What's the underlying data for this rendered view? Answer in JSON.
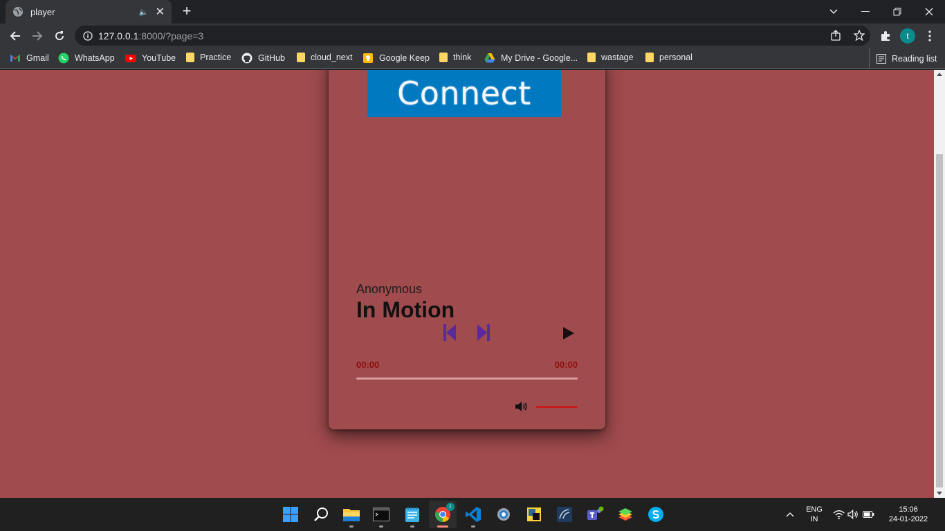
{
  "browser": {
    "tab_title": "player",
    "address": {
      "host": "127.0.0.1",
      "path": ":8000/?page=3"
    },
    "profile_initial": "t",
    "bookmarks": [
      {
        "label": "Gmail",
        "icon": "gmail-icon"
      },
      {
        "label": "WhatsApp",
        "icon": "whatsapp-icon"
      },
      {
        "label": "YouTube",
        "icon": "youtube-icon"
      },
      {
        "label": "Practice",
        "icon": "folder-icon"
      },
      {
        "label": "GitHub",
        "icon": "github-icon"
      },
      {
        "label": "cloud_next",
        "icon": "folder-icon"
      },
      {
        "label": "Google Keep",
        "icon": "keep-icon"
      },
      {
        "label": "think",
        "icon": "folder-icon"
      },
      {
        "label": "My Drive - Google...",
        "icon": "drive-icon"
      },
      {
        "label": "wastage",
        "icon": "folder-icon"
      },
      {
        "label": "personal",
        "icon": "folder-icon"
      }
    ],
    "reading_list": "Reading list"
  },
  "player": {
    "cover_text": "Connect",
    "artist": "Anonymous",
    "title": "In Motion",
    "current_time": "00:00",
    "duration": "00:00",
    "progress_fraction": 0,
    "volume_fraction": 1,
    "colors": {
      "background": "#a04b4d",
      "accent": "#c71a1a",
      "nav_buttons": "#5b2a9a",
      "cover": "#0079c1"
    }
  },
  "taskbar": {
    "language": "ENG",
    "region": "IN",
    "time": "15:06",
    "date": "24-01-2022"
  }
}
